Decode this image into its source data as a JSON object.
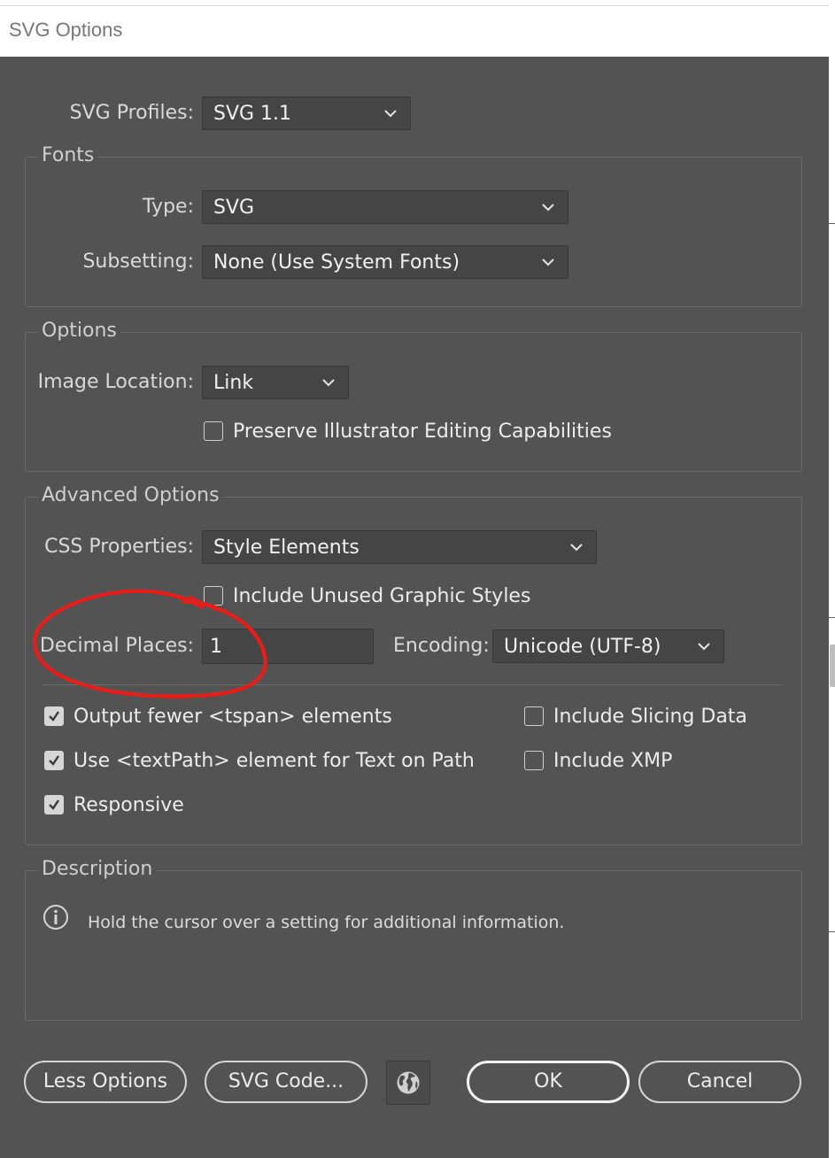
{
  "window": {
    "title": "SVG Options"
  },
  "profiles": {
    "label": "SVG Profiles:",
    "value": "SVG 1.1"
  },
  "fonts": {
    "group_title": "Fonts",
    "type_label": "Type:",
    "type_value": "SVG",
    "subsetting_label": "Subsetting:",
    "subsetting_value": "None (Use System Fonts)"
  },
  "options": {
    "group_title": "Options",
    "image_location_label": "Image Location:",
    "image_location_value": "Link",
    "preserve_label": "Preserve Illustrator Editing Capabilities",
    "preserve_checked": false
  },
  "advanced": {
    "group_title": "Advanced Options",
    "css_label": "CSS Properties:",
    "css_value": "Style Elements",
    "unused_styles_label": "Include Unused Graphic Styles",
    "unused_styles_checked": false,
    "decimal_label": "Decimal Places:",
    "decimal_value": "1",
    "encoding_label": "Encoding:",
    "encoding_value": "Unicode (UTF-8)",
    "checkboxes": [
      {
        "label": "Output fewer <tspan> elements",
        "checked": true
      },
      {
        "label": "Use <textPath> element for Text on Path",
        "checked": true
      },
      {
        "label": "Responsive",
        "checked": true
      },
      {
        "label": "Include Slicing Data",
        "checked": false
      },
      {
        "label": "Include XMP",
        "checked": false
      }
    ]
  },
  "description": {
    "group_title": "Description",
    "text": "Hold the cursor over a setting for additional information."
  },
  "buttons": {
    "less_options": "Less Options",
    "svg_code": "SVG Code...",
    "ok": "OK",
    "cancel": "Cancel"
  },
  "colors": {
    "panel_bg": "#535353",
    "field_bg": "#454545",
    "annotation_red": "#e0201c"
  }
}
